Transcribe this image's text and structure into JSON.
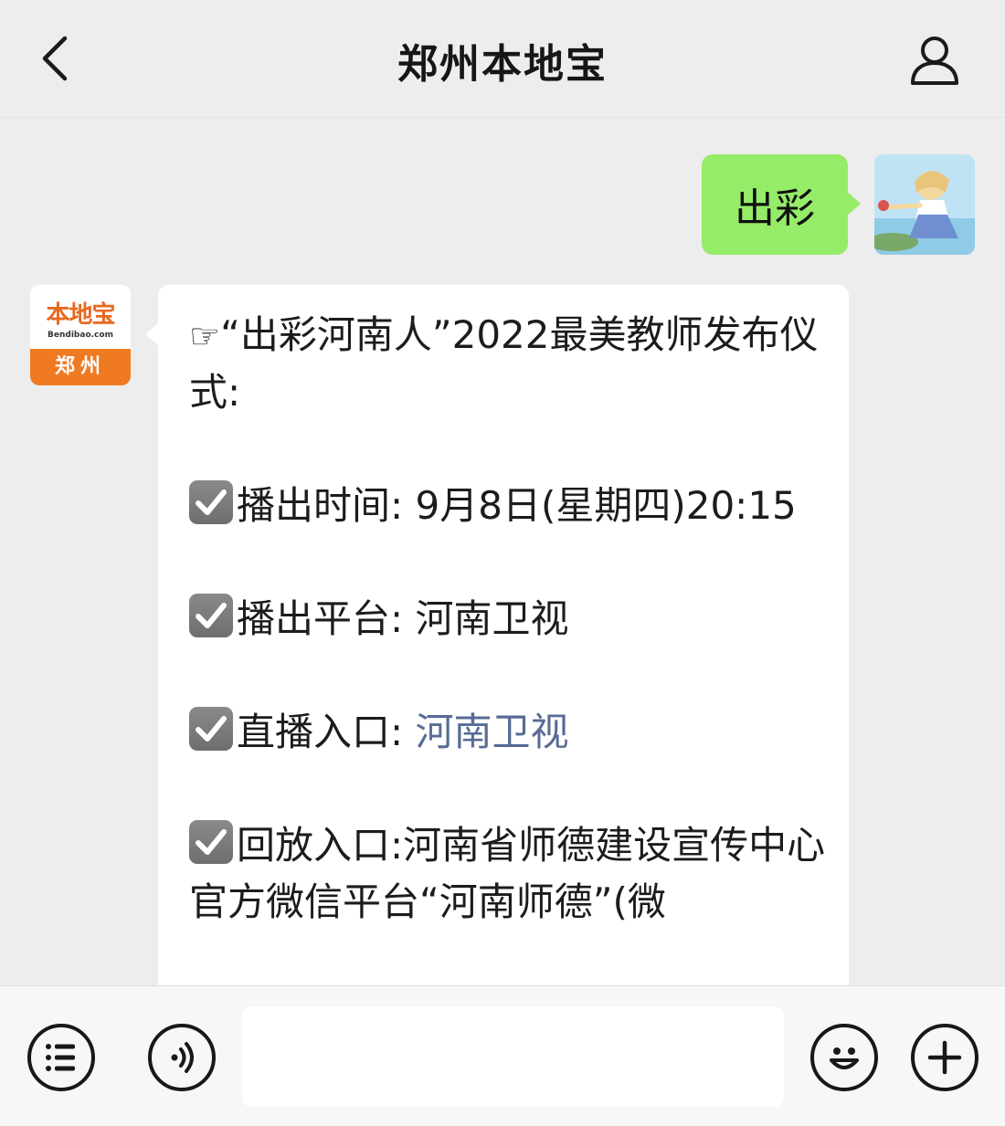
{
  "header": {
    "title": "郑州本地宝",
    "back_icon": "chevron-left-icon",
    "profile_icon": "person-icon"
  },
  "messages": {
    "outgoing": {
      "text": "出彩"
    },
    "bot_avatar": {
      "logo_cn": "本地宝",
      "logo_en": "Bendibao.com",
      "city": "郑州"
    },
    "incoming": {
      "pointer": "☞",
      "headline": "“出彩河南人”2022最美教师发布仪式:",
      "items": [
        {
          "label": "播出时间:",
          "value": "9月8日(星期四)20:15",
          "is_link": false
        },
        {
          "label": "播出平台:",
          "value": "河南卫视",
          "is_link": false
        },
        {
          "label": "直播入口:",
          "value": "河南卫视",
          "is_link": true
        },
        {
          "label": "回放入口:",
          "value": "河南省师德建设宣传中心官方微信平台“河南师德”(微",
          "is_link": false
        }
      ]
    }
  },
  "input_bar": {
    "menu_icon": "list-menu-icon",
    "voice_icon": "voice-icon",
    "emoji_icon": "emoji-icon",
    "add_icon": "plus-icon",
    "input_value": ""
  },
  "colors": {
    "background": "#ededed",
    "outgoing_bubble": "#95ec69",
    "link": "#576b95",
    "brand_orange": "#f07a22"
  }
}
